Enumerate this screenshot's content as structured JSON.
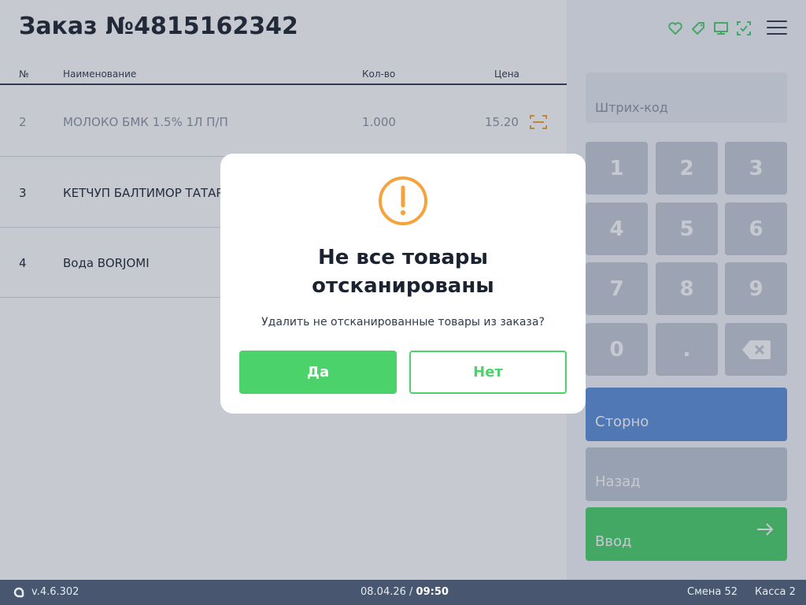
{
  "order": {
    "title": "Заказ №4815162342"
  },
  "table": {
    "headers": {
      "num": "№",
      "name": "Наименование",
      "qty": "Кол-во",
      "price": "Цена"
    },
    "rows": [
      {
        "num": "2",
        "name": "МОЛОКО БМК 1.5% 1Л П/П",
        "qty": "1.000",
        "price": "15.20",
        "scanned": true
      },
      {
        "num": "3",
        "name": "КЕТЧУП БАЛТИМОР ТАТАРСКИЙ",
        "qty": "",
        "price": "",
        "scanned": false
      },
      {
        "num": "4",
        "name": "Вода BORJOMI",
        "qty": "",
        "price": "",
        "scanned": false
      }
    ]
  },
  "toolbar": {
    "icons": [
      "heart-icon",
      "tag-icon",
      "monitor-icon",
      "scan-check-icon",
      "menu-icon"
    ],
    "accent": "#4cd26b"
  },
  "barcode": {
    "placeholder": "Штрих-код"
  },
  "keypad": {
    "keys": [
      "1",
      "2",
      "3",
      "4",
      "5",
      "6",
      "7",
      "8",
      "9",
      "0",
      ".",
      "backspace"
    ]
  },
  "actions": {
    "storno": "Сторно",
    "back": "Назад",
    "enter": "Ввод"
  },
  "footer": {
    "version": "v.4.6.302",
    "date": "08.04.26",
    "separator": " / ",
    "time": "09:50",
    "shift": "Смена 52",
    "cash": "Касса 2"
  },
  "modal": {
    "title_line1": "Не все товары",
    "title_line2": "отсканированы",
    "text": "Удалить не отсканированные товары из заказа?",
    "yes": "Да",
    "no": "Нет",
    "warn_color": "#f5a33a"
  }
}
